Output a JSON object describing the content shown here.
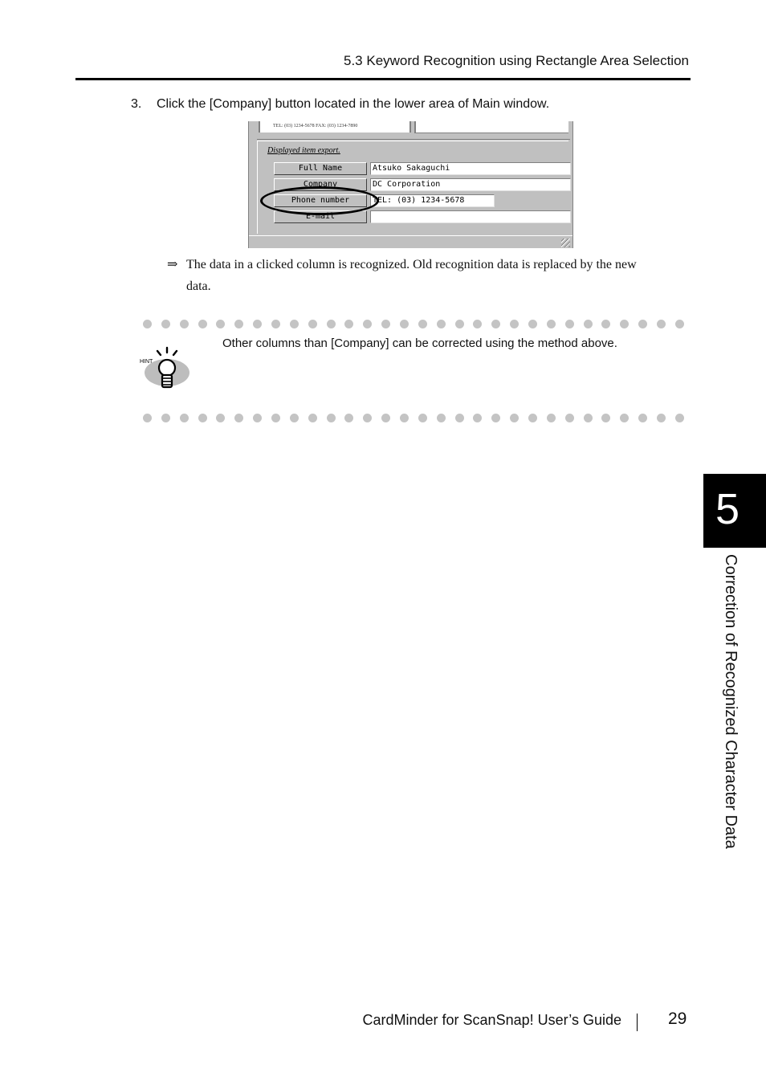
{
  "header": {
    "section_title": "5.3 Keyword Recognition using Rectangle Area Selection"
  },
  "step": {
    "number": "3.",
    "text": "Click the [Company] button located in the lower area of Main window."
  },
  "screenshot": {
    "card_lines": [
      "TEL: (03) 1234-5678    FAX: (03) 1234-7890"
    ],
    "panel_title": "Displayed item export.",
    "fields": [
      {
        "label": "Full Name",
        "value": "Atsuko Sakaguchi"
      },
      {
        "label": "Company",
        "value": "DC Corporation"
      },
      {
        "label": "Phone number",
        "value": "TEL: (03) 1234-5678"
      },
      {
        "label": "E-mail",
        "value": ""
      }
    ]
  },
  "result": {
    "arrow": "⇒",
    "line1": "The data in a clicked column is recognized. Old recognition data is replaced by the new",
    "line2": "data."
  },
  "hint": {
    "icon_label": "HINT",
    "text": "Other columns than [Company] can be corrected using the method above."
  },
  "side_tab": {
    "chapter_number": "5",
    "chapter_title": "Correction of Recognized Character Data"
  },
  "footer": {
    "guide_title": "CardMinder for ScanSnap! User’s Guide",
    "page_number": "29"
  }
}
